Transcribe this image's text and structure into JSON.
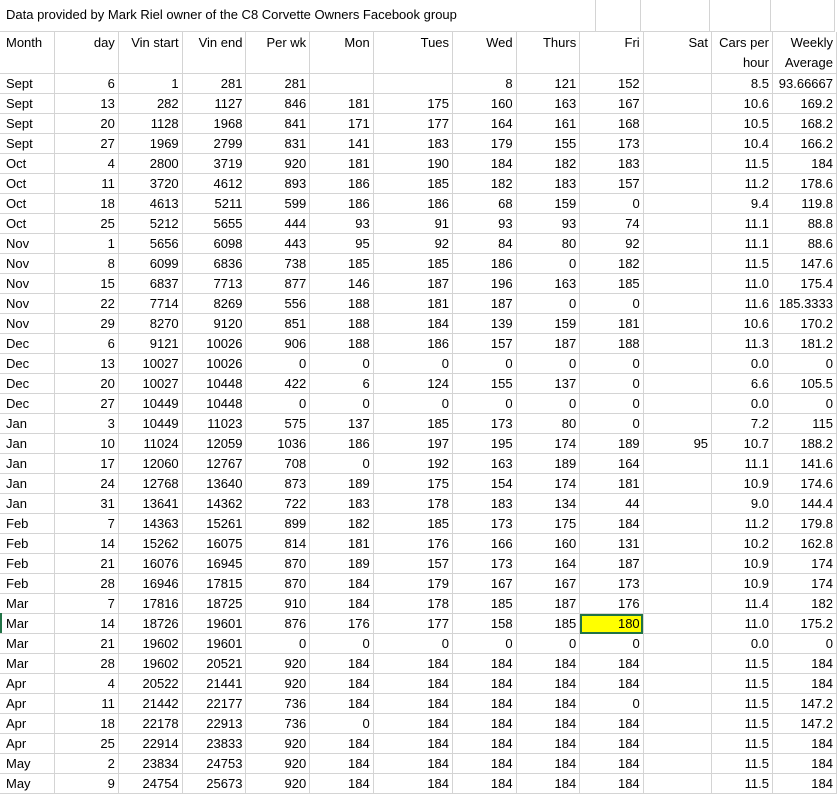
{
  "title": "Data provided by Mark Riel owner of the C8 Corvette Owners Facebook group",
  "headers": [
    {
      "line1": "Month",
      "line2": "",
      "align": "left"
    },
    {
      "line1": "day",
      "line2": "",
      "align": "right"
    },
    {
      "line1": "Vin start",
      "line2": "",
      "align": "right"
    },
    {
      "line1": "Vin end",
      "line2": "",
      "align": "right"
    },
    {
      "line1": "Per wk",
      "line2": "",
      "align": "right"
    },
    {
      "line1": "Mon",
      "line2": "",
      "align": "right"
    },
    {
      "line1": "Tues",
      "line2": "",
      "align": "right"
    },
    {
      "line1": "Wed",
      "line2": "",
      "align": "right"
    },
    {
      "line1": "Thurs",
      "line2": "",
      "align": "right"
    },
    {
      "line1": "Fri",
      "line2": "",
      "align": "right"
    },
    {
      "line1": "Sat",
      "line2": "",
      "align": "right"
    },
    {
      "line1": "Cars per",
      "line2": "hour",
      "align": "right"
    },
    {
      "line1": "Weekly",
      "line2": "Average",
      "align": "right"
    }
  ],
  "rows": [
    [
      "Sept",
      "6",
      "1",
      "281",
      "281",
      "",
      "",
      "8",
      "121",
      "152",
      "",
      "8.5",
      "93.66667"
    ],
    [
      "Sept",
      "13",
      "282",
      "1127",
      "846",
      "181",
      "175",
      "160",
      "163",
      "167",
      "",
      "10.6",
      "169.2"
    ],
    [
      "Sept",
      "20",
      "1128",
      "1968",
      "841",
      "171",
      "177",
      "164",
      "161",
      "168",
      "",
      "10.5",
      "168.2"
    ],
    [
      "Sept",
      "27",
      "1969",
      "2799",
      "831",
      "141",
      "183",
      "179",
      "155",
      "173",
      "",
      "10.4",
      "166.2"
    ],
    [
      "Oct",
      "4",
      "2800",
      "3719",
      "920",
      "181",
      "190",
      "184",
      "182",
      "183",
      "",
      "11.5",
      "184"
    ],
    [
      "Oct",
      "11",
      "3720",
      "4612",
      "893",
      "186",
      "185",
      "182",
      "183",
      "157",
      "",
      "11.2",
      "178.6"
    ],
    [
      "Oct",
      "18",
      "4613",
      "5211",
      "599",
      "186",
      "186",
      "68",
      "159",
      "0",
      "",
      "9.4",
      "119.8"
    ],
    [
      "Oct",
      "25",
      "5212",
      "5655",
      "444",
      "93",
      "91",
      "93",
      "93",
      "74",
      "",
      "11.1",
      "88.8"
    ],
    [
      "Nov",
      "1",
      "5656",
      "6098",
      "443",
      "95",
      "92",
      "84",
      "80",
      "92",
      "",
      "11.1",
      "88.6"
    ],
    [
      "Nov",
      "8",
      "6099",
      "6836",
      "738",
      "185",
      "185",
      "186",
      "0",
      "182",
      "",
      "11.5",
      "147.6"
    ],
    [
      "Nov",
      "15",
      "6837",
      "7713",
      "877",
      "146",
      "187",
      "196",
      "163",
      "185",
      "",
      "11.0",
      "175.4"
    ],
    [
      "Nov",
      "22",
      "7714",
      "8269",
      "556",
      "188",
      "181",
      "187",
      "0",
      "0",
      "",
      "11.6",
      "185.3333"
    ],
    [
      "Nov",
      "29",
      "8270",
      "9120",
      "851",
      "188",
      "184",
      "139",
      "159",
      "181",
      "",
      "10.6",
      "170.2"
    ],
    [
      "Dec",
      "6",
      "9121",
      "10026",
      "906",
      "188",
      "186",
      "157",
      "187",
      "188",
      "",
      "11.3",
      "181.2"
    ],
    [
      "Dec",
      "13",
      "10027",
      "10026",
      "0",
      "0",
      "0",
      "0",
      "0",
      "0",
      "",
      "0.0",
      "0"
    ],
    [
      "Dec",
      "20",
      "10027",
      "10448",
      "422",
      "6",
      "124",
      "155",
      "137",
      "0",
      "",
      "6.6",
      "105.5"
    ],
    [
      "Dec",
      "27",
      "10449",
      "10448",
      "0",
      "0",
      "0",
      "0",
      "0",
      "0",
      "",
      "0.0",
      "0"
    ],
    [
      "Jan",
      "3",
      "10449",
      "11023",
      "575",
      "137",
      "185",
      "173",
      "80",
      "0",
      "",
      "7.2",
      "115"
    ],
    [
      "Jan",
      "10",
      "11024",
      "12059",
      "1036",
      "186",
      "197",
      "195",
      "174",
      "189",
      "95",
      "10.7",
      "188.2"
    ],
    [
      "Jan",
      "17",
      "12060",
      "12767",
      "708",
      "0",
      "192",
      "163",
      "189",
      "164",
      "",
      "11.1",
      "141.6"
    ],
    [
      "Jan",
      "24",
      "12768",
      "13640",
      "873",
      "189",
      "175",
      "154",
      "174",
      "181",
      "",
      "10.9",
      "174.6"
    ],
    [
      "Jan",
      "31",
      "13641",
      "14362",
      "722",
      "183",
      "178",
      "183",
      "134",
      "44",
      "",
      "9.0",
      "144.4"
    ],
    [
      "Feb",
      "7",
      "14363",
      "15261",
      "899",
      "182",
      "185",
      "173",
      "175",
      "184",
      "",
      "11.2",
      "179.8"
    ],
    [
      "Feb",
      "14",
      "15262",
      "16075",
      "814",
      "181",
      "176",
      "166",
      "160",
      "131",
      "",
      "10.2",
      "162.8"
    ],
    [
      "Feb",
      "21",
      "16076",
      "16945",
      "870",
      "189",
      "157",
      "173",
      "164",
      "187",
      "",
      "10.9",
      "174"
    ],
    [
      "Feb",
      "28",
      "16946",
      "17815",
      "870",
      "184",
      "179",
      "167",
      "167",
      "173",
      "",
      "10.9",
      "174"
    ],
    [
      "Mar",
      "7",
      "17816",
      "18725",
      "910",
      "184",
      "178",
      "185",
      "187",
      "176",
      "",
      "11.4",
      "182"
    ],
    [
      "Mar",
      "14",
      "18726",
      "19601",
      "876",
      "176",
      "177",
      "158",
      "185",
      "180",
      "",
      "11.0",
      "175.2"
    ],
    [
      "Mar",
      "21",
      "19602",
      "19601",
      "0",
      "0",
      "0",
      "0",
      "0",
      "0",
      "",
      "0.0",
      "0"
    ],
    [
      "Mar",
      "28",
      "19602",
      "20521",
      "920",
      "184",
      "184",
      "184",
      "184",
      "184",
      "",
      "11.5",
      "184"
    ],
    [
      "Apr",
      "4",
      "20522",
      "21441",
      "920",
      "184",
      "184",
      "184",
      "184",
      "184",
      "",
      "11.5",
      "184"
    ],
    [
      "Apr",
      "11",
      "21442",
      "22177",
      "736",
      "184",
      "184",
      "184",
      "184",
      "0",
      "",
      "11.5",
      "147.2"
    ],
    [
      "Apr",
      "18",
      "22178",
      "22913",
      "736",
      "0",
      "184",
      "184",
      "184",
      "184",
      "",
      "11.5",
      "147.2"
    ],
    [
      "Apr",
      "25",
      "22914",
      "23833",
      "920",
      "184",
      "184",
      "184",
      "184",
      "184",
      "",
      "11.5",
      "184"
    ],
    [
      "May",
      "2",
      "23834",
      "24753",
      "920",
      "184",
      "184",
      "184",
      "184",
      "184",
      "",
      "11.5",
      "184"
    ],
    [
      "May",
      "9",
      "24754",
      "25673",
      "920",
      "184",
      "184",
      "184",
      "184",
      "184",
      "",
      "11.5",
      "184"
    ]
  ],
  "highlight": {
    "row": 27,
    "col": 9,
    "color": "#ffff00"
  },
  "colors": {
    "gridline": "#d4d4d4",
    "selection": "#217346",
    "highlight": "#ffff00"
  }
}
